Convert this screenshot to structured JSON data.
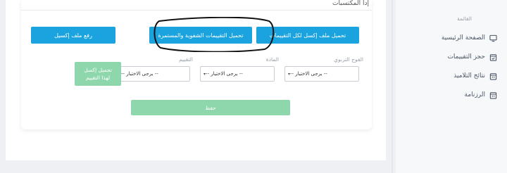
{
  "card": {
    "title": "إدا المكتسبات"
  },
  "buttons": {
    "upload_excel": "رفع ملف إكسيل",
    "download_oral": "تحميل التقييمات الشفوية والمستمرة",
    "download_all": "تحميل ملف إكسل لكل التقييمات",
    "download_assessment_line1": "تحميل إكسل",
    "download_assessment_line2": "لهذا التقييم",
    "save": "حفظ"
  },
  "filters": {
    "group": {
      "label": "الفوج التربوي",
      "value": "-- يرجى الاختيار --"
    },
    "subject": {
      "label": "المادة",
      "value": "-- يرجى الاختيار --"
    },
    "assessment": {
      "label": "التقييم",
      "value": "-- يرجى الاختيار --"
    }
  },
  "sidebar": {
    "heading": "القائمة",
    "items": [
      {
        "label": "الصفحة الرئيسية",
        "icon": "monitor-icon"
      },
      {
        "label": "حجز التقييمات",
        "icon": "calendar-check-icon"
      },
      {
        "label": "نتائج التلاميذ",
        "icon": "calendar-icon"
      },
      {
        "label": "الرزنامة",
        "icon": "calendar-icon"
      }
    ]
  },
  "colors": {
    "primary": "#1aa3df",
    "success_disabled": "#8ed7ac",
    "annotation": "#111111"
  }
}
